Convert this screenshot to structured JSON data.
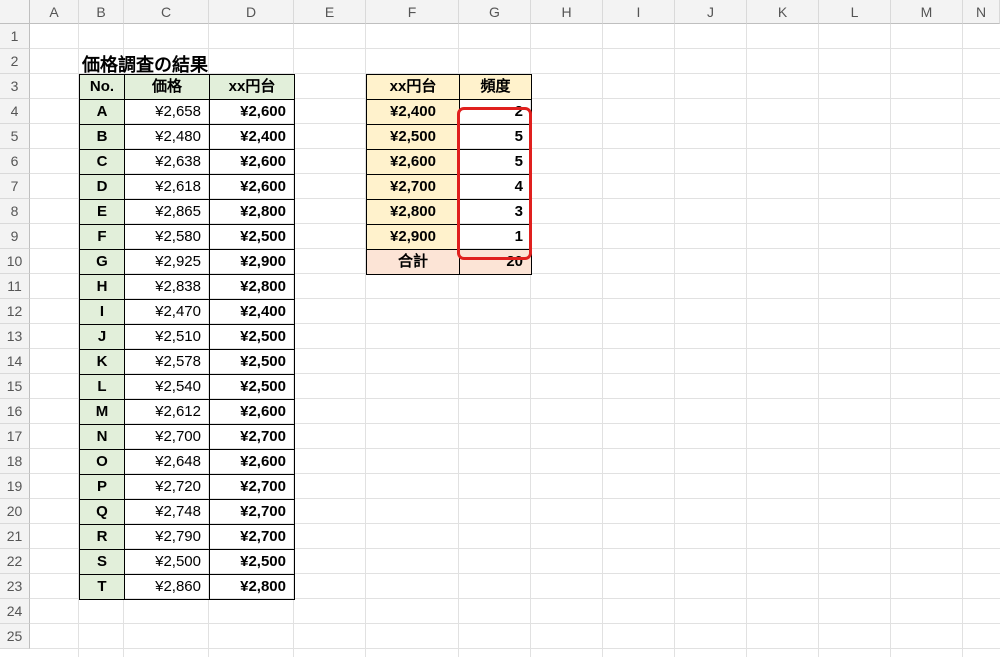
{
  "columns": [
    "A",
    "B",
    "C",
    "D",
    "E",
    "F",
    "G",
    "H",
    "I",
    "J",
    "K",
    "L",
    "M",
    "N"
  ],
  "rows": [
    "1",
    "2",
    "3",
    "4",
    "5",
    "6",
    "7",
    "8",
    "9",
    "10",
    "11",
    "12",
    "13",
    "14",
    "15",
    "16",
    "17",
    "18",
    "19",
    "20",
    "21",
    "22",
    "23",
    "24",
    "25"
  ],
  "title": "価格調査の結果",
  "table1": {
    "headers": [
      "No.",
      "価格",
      "xx円台"
    ],
    "rows": [
      [
        "A",
        "¥2,658",
        "¥2,600"
      ],
      [
        "B",
        "¥2,480",
        "¥2,400"
      ],
      [
        "C",
        "¥2,638",
        "¥2,600"
      ],
      [
        "D",
        "¥2,618",
        "¥2,600"
      ],
      [
        "E",
        "¥2,865",
        "¥2,800"
      ],
      [
        "F",
        "¥2,580",
        "¥2,500"
      ],
      [
        "G",
        "¥2,925",
        "¥2,900"
      ],
      [
        "H",
        "¥2,838",
        "¥2,800"
      ],
      [
        "I",
        "¥2,470",
        "¥2,400"
      ],
      [
        "J",
        "¥2,510",
        "¥2,500"
      ],
      [
        "K",
        "¥2,578",
        "¥2,500"
      ],
      [
        "L",
        "¥2,540",
        "¥2,500"
      ],
      [
        "M",
        "¥2,612",
        "¥2,600"
      ],
      [
        "N",
        "¥2,700",
        "¥2,700"
      ],
      [
        "O",
        "¥2,648",
        "¥2,600"
      ],
      [
        "P",
        "¥2,720",
        "¥2,700"
      ],
      [
        "Q",
        "¥2,748",
        "¥2,700"
      ],
      [
        "R",
        "¥2,790",
        "¥2,700"
      ],
      [
        "S",
        "¥2,500",
        "¥2,500"
      ],
      [
        "T",
        "¥2,860",
        "¥2,800"
      ]
    ]
  },
  "table2": {
    "headers": [
      "xx円台",
      "頻度"
    ],
    "rows": [
      [
        "¥2,400",
        "2"
      ],
      [
        "¥2,500",
        "5"
      ],
      [
        "¥2,600",
        "5"
      ],
      [
        "¥2,700",
        "4"
      ],
      [
        "¥2,800",
        "3"
      ],
      [
        "¥2,900",
        "1"
      ]
    ],
    "total_label": "合計",
    "total_value": "20"
  },
  "colors": {
    "green": "#e2efda",
    "yellow": "#fff2cc",
    "pink": "#fce4d6",
    "highlight": "#e0201e"
  }
}
